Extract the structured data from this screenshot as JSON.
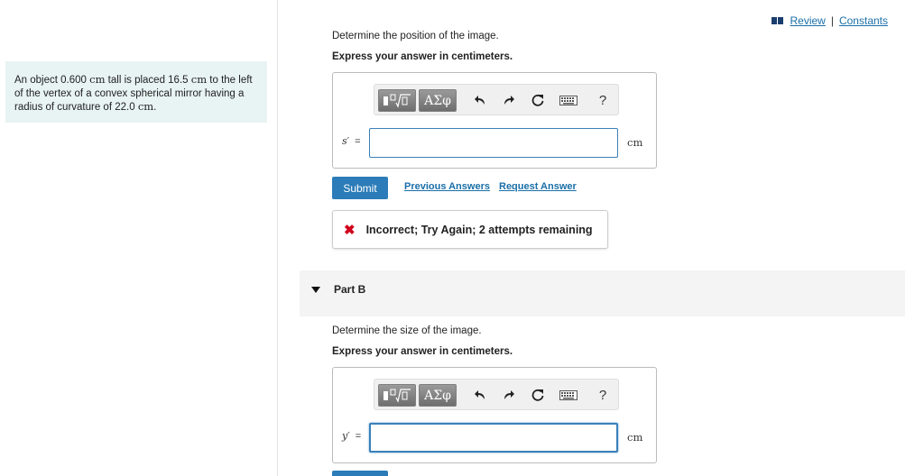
{
  "header": {
    "review_label": "Review",
    "separator": "|",
    "constants_label": "Constants"
  },
  "problem": {
    "part1": "An object 0.600 ",
    "unit1": "cm",
    "part2": " tall is placed 16.5 ",
    "unit2": "cm",
    "part3": " to the left of the vertex of a convex spherical mirror having a radius of curvature of 22.0 ",
    "unit3": "cm",
    "part4": "."
  },
  "part_a": {
    "question": "Determine the position of the image.",
    "instruction": "Express your answer in centimeters.",
    "variable": "s′",
    "equals": "=",
    "input_value": "",
    "unit": "cm",
    "toolbar": {
      "greek_label": "ΑΣφ",
      "help_label": "?"
    },
    "submit_label": "Submit",
    "previous_answers_label": "Previous Answers",
    "request_answer_label": "Request Answer",
    "feedback": {
      "icon": "✖",
      "text": "Incorrect; Try Again; 2 attempts remaining"
    }
  },
  "part_b": {
    "title": "Part B",
    "question": "Determine the size of the image.",
    "instruction": "Express your answer in centimeters.",
    "variable": "y′",
    "equals": "=",
    "input_value": "",
    "unit": "cm",
    "toolbar": {
      "greek_label": "ΑΣφ",
      "help_label": "?"
    }
  },
  "colors": {
    "accent": "#2b7cb8",
    "link": "#1a6fa8",
    "problem_bg": "#e8f3f4",
    "error": "#d0021b"
  }
}
